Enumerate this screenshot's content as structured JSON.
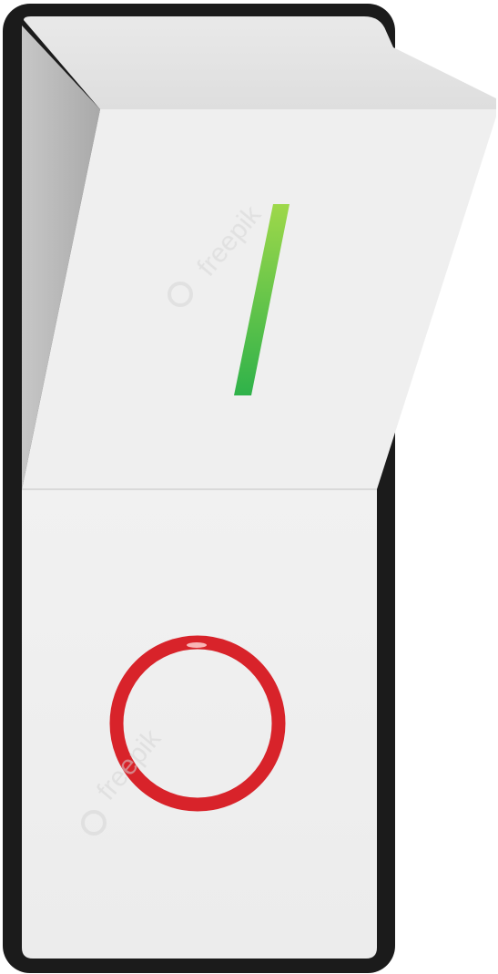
{
  "switch": {
    "state": "on",
    "on_symbol": "I",
    "off_symbol": "O",
    "colors": {
      "housing": "#1b1b1b",
      "face": "#efefef",
      "rocker_top": "#e6e6e6",
      "rocker_side": "#bdbdbd",
      "on_indicator_top": "#9ed84a",
      "on_indicator_bottom": "#2fb24a",
      "off_indicator": "#d8232a"
    }
  },
  "watermark": {
    "text": "freepik",
    "color": "#d6d6d6"
  }
}
